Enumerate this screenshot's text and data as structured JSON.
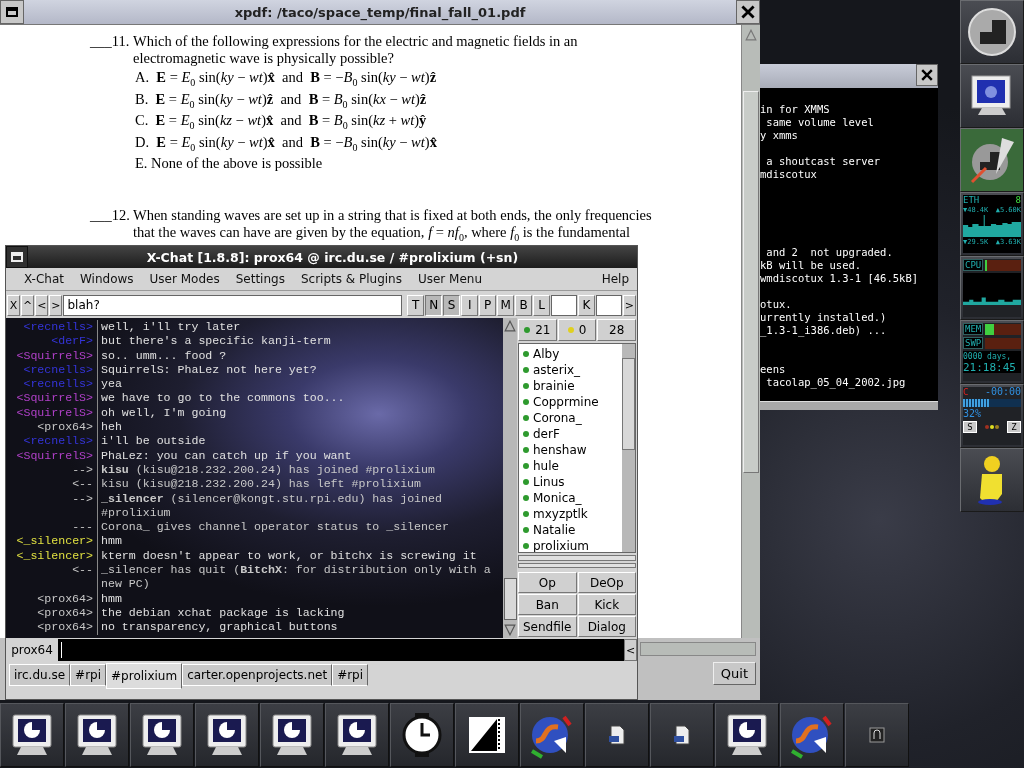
{
  "pdf_viewer": {
    "title": "xpdf: /taco/space_temp/final_fall_01.pdf",
    "questions": [
      {
        "number": "___11.",
        "lines": [
          "Which of the following expressions for the electric and magnetic fields in an",
          "electromagnetic wave is physically possible?"
        ],
        "choices": [
          "A.  **E** = *E*$_{0}$ sin(*ky* − *wt*)**x̂**  and  **B** = −*B*$_{0}$ sin(*ky* − *wt*)**ẑ**",
          "B.  **E** = *E*$_{0}$ sin(*ky* − *wt*)**ẑ**  and  **B** = *B*$_{0}$ sin(*kx* − *wt*)**ẑ**",
          "C.  **E** = *E*$_{0}$ sin(*kz* − *wt*)**x̂**  and  **B** = *B*$_{0}$ sin(*kz* + *wt*)**ŷ**",
          "D.  **E** = *E*$_{0}$ sin(*ky* − *wt*)**x̂**  and  **B** = −*B*$_{0}$ sin(*ky* − *wt*)**x̂**",
          "E. None of the above is possible"
        ]
      },
      {
        "number": "___12.",
        "lines": [
          "When standing waves are set up in a string that is fixed at both ends, the only frequencies",
          "that the waves can have are given by the equation,  *f* = *nf*$_{0}$,  where *f*$_{0}$ is the fundamental"
        ]
      }
    ],
    "quit_button": "Quit"
  },
  "terminal": {
    "blocks": [
      [
        "in for XMMS",
        " same volume level",
        "y xmms"
      ],
      [
        " a shoutcast server",
        "mdiscotux"
      ],
      [
        " and 2  not upgraded.",
        "kB will be used.",
        "wmdiscotux 1.3-1 [46.5kB]"
      ],
      [
        "otux.",
        "urrently installed.)",
        "_1.3-1_i386.deb) ..."
      ],
      [
        "eens",
        " tacolap_05_04_2002.jpg"
      ]
    ]
  },
  "chat": {
    "title": "X-Chat [1.8.8]: prox64 @ irc.du.se / #prolixium (+sn)",
    "menu": [
      "X-Chat",
      "Windows",
      "User Modes",
      "Settings",
      "Scripts & Plugins",
      "User Menu"
    ],
    "help_menu": "Help",
    "nav_buttons": [
      "X",
      "^",
      "<",
      ">"
    ],
    "topic": "blah?",
    "mode_buttons": [
      {
        "label": "T",
        "selected": false
      },
      {
        "label": "N",
        "selected": true
      },
      {
        "label": "S",
        "selected": true
      },
      {
        "label": "I",
        "selected": false
      },
      {
        "label": "P",
        "selected": false
      },
      {
        "label": "M",
        "selected": false
      },
      {
        "label": "B",
        "selected": false
      },
      {
        "label": "L",
        "selected": false
      }
    ],
    "key_button": "K",
    "end_button": ">",
    "lines": [
      {
        "kind": "message",
        "prefix": "<recnells>",
        "color": "#3434d8",
        "text": "well, i'll try later"
      },
      {
        "kind": "message",
        "prefix": "<derF>",
        "color": "#3434d8",
        "text": "but there's a specific kanji-term"
      },
      {
        "kind": "message",
        "prefix": "<SquirrelS>",
        "color": "#b040c8",
        "text": "so.. umm... food ?"
      },
      {
        "kind": "message",
        "prefix": "<recnells>",
        "color": "#3434d8",
        "text": "SquirrelS: PhaLez not here yet?"
      },
      {
        "kind": "message",
        "prefix": "<recnells>",
        "color": "#3434d8",
        "text": "yea"
      },
      {
        "kind": "message",
        "prefix": "<SquirrelS>",
        "color": "#b040c8",
        "text": "we have to go to the commons too..."
      },
      {
        "kind": "message",
        "prefix": "<SquirrelS>",
        "color": "#b040c8",
        "text": "oh well, I'm going"
      },
      {
        "kind": "message",
        "prefix": "<prox64>",
        "color": "#c8c8c8",
        "text": "heh"
      },
      {
        "kind": "message",
        "prefix": "<recnells>",
        "color": "#3434d8",
        "text": "i'll be outside"
      },
      {
        "kind": "message",
        "prefix": "<SquirrelS>",
        "color": "#b040c8",
        "text": "PhaLez: you can catch up if you want"
      },
      {
        "kind": "event",
        "prefix": "-->",
        "text": "**kisu** (kisu@218.232.200.24) has joined #prolixium"
      },
      {
        "kind": "event",
        "prefix": "<--",
        "text": "kisu (kisu@218.232.200.24) has left #prolixium"
      },
      {
        "kind": "event",
        "prefix": "-->",
        "text": "**_silencer** (silencer@kongt.stu.rpi.edu) has joined #prolixium"
      },
      {
        "kind": "event",
        "prefix": "---",
        "text": "Corona_ gives channel operator status to _silencer"
      },
      {
        "kind": "message",
        "prefix": "<_silencer>",
        "color": "#e0e040",
        "text": "hmm"
      },
      {
        "kind": "message",
        "prefix": "<_silencer>",
        "color": "#e0e040",
        "text": "kterm doesn't appear to work, or bitchx is screwing it"
      },
      {
        "kind": "event",
        "prefix": "<--",
        "text": "_silencer has quit (**BitchX**: for distribution only with a new PC)"
      },
      {
        "kind": "message",
        "prefix": "<prox64>",
        "color": "#c8c8c8",
        "text": "hmm"
      },
      {
        "kind": "message",
        "prefix": "<prox64>",
        "color": "#c8c8c8",
        "text": "the debian xchat package is lacking"
      },
      {
        "kind": "message",
        "prefix": "<prox64>",
        "color": "#c8c8c8",
        "text": "no transparency, graphical buttons"
      }
    ],
    "user_counts": [
      {
        "kind": "op",
        "count": "21"
      },
      {
        "kind": "voice",
        "count": "0"
      },
      {
        "kind": "total",
        "count": "28"
      }
    ],
    "users": [
      {
        "name": "Alby",
        "op": true
      },
      {
        "name": "asterix_",
        "op": true
      },
      {
        "name": "brainie",
        "op": true
      },
      {
        "name": "Copprmine",
        "op": true
      },
      {
        "name": "Corona_",
        "op": true
      },
      {
        "name": "derF",
        "op": true
      },
      {
        "name": "henshaw",
        "op": true
      },
      {
        "name": "hule",
        "op": true
      },
      {
        "name": "Linus",
        "op": true
      },
      {
        "name": "Monica_",
        "op": true
      },
      {
        "name": "mxyzptlk",
        "op": true
      },
      {
        "name": "Natalie",
        "op": true
      },
      {
        "name": "prolixium",
        "op": true
      }
    ],
    "user_buttons": [
      "Op",
      "DeOp",
      "Ban",
      "Kick",
      "Sendfile",
      "Dialog"
    ],
    "nick": "prox64",
    "input_button": "<",
    "tabs": [
      {
        "label": "irc.du.se",
        "selected": false
      },
      {
        "label": "#rpi",
        "selected": false
      },
      {
        "label": "#prolixium",
        "selected": true
      },
      {
        "label": "carter.openprojects.net",
        "selected": false
      },
      {
        "label": "#rpi",
        "selected": false
      }
    ]
  },
  "dock": {
    "net": {
      "label": "ETH",
      "status": "8",
      "down_rate": "▼48.4K",
      "up_rate": "▲5.60K",
      "down_total": "▼29.5K",
      "up_total": "▲3.63K"
    },
    "cpu": {
      "label": "CPU",
      "level": 0.06
    },
    "mem": {
      "label": "MEM",
      "level": 0.25
    },
    "swap": {
      "label": "SWP",
      "level": 0
    },
    "uptime": {
      "days": "0000 days,",
      "time": "21:18:45"
    },
    "player": {
      "mark": "C",
      "time": "-00:00",
      "level": 0.45,
      "volume": "32%",
      "buttons": [
        "S",
        "Z"
      ]
    }
  }
}
